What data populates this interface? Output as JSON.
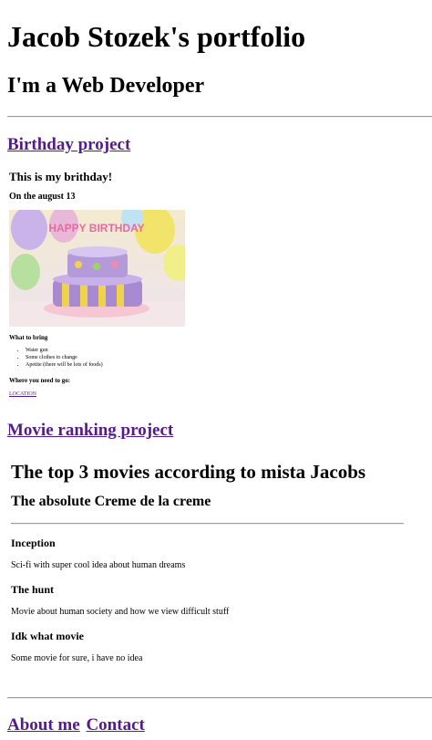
{
  "header": {
    "title": "Jacob Stozek's portfolio",
    "subtitle": "I'm a Web Developer"
  },
  "birthday": {
    "link_label": "Birthday project",
    "heading": "This is my brithday!",
    "date": "On the august 13",
    "image_banner": "HAPPY BIRTHDAY",
    "bring_label": "What to bring",
    "bring_items": [
      "Water gun",
      "Some clothes to change",
      "Apetite (there will be lots of foods)"
    ],
    "where_label": "Where you need to go:",
    "location_link": "LOCATION"
  },
  "movies": {
    "link_label": "Movie ranking project",
    "title": "The top 3 movies according to mista Jacobs",
    "subtitle": "The absolute Creme de la creme",
    "items": [
      {
        "name": "Inception",
        "description": "Sci-fi with super cool idea about human dreams"
      },
      {
        "name": "The hunt",
        "description": "Movie about human society and how we view difficult stuff"
      },
      {
        "name": "Idk what movie",
        "description": "Some movie for sure, i have no idea"
      }
    ]
  },
  "footer_nav": {
    "about": "About me",
    "contact": "Contact"
  },
  "colors": {
    "link": "#551a8b",
    "divider": "#9a9a9a"
  }
}
